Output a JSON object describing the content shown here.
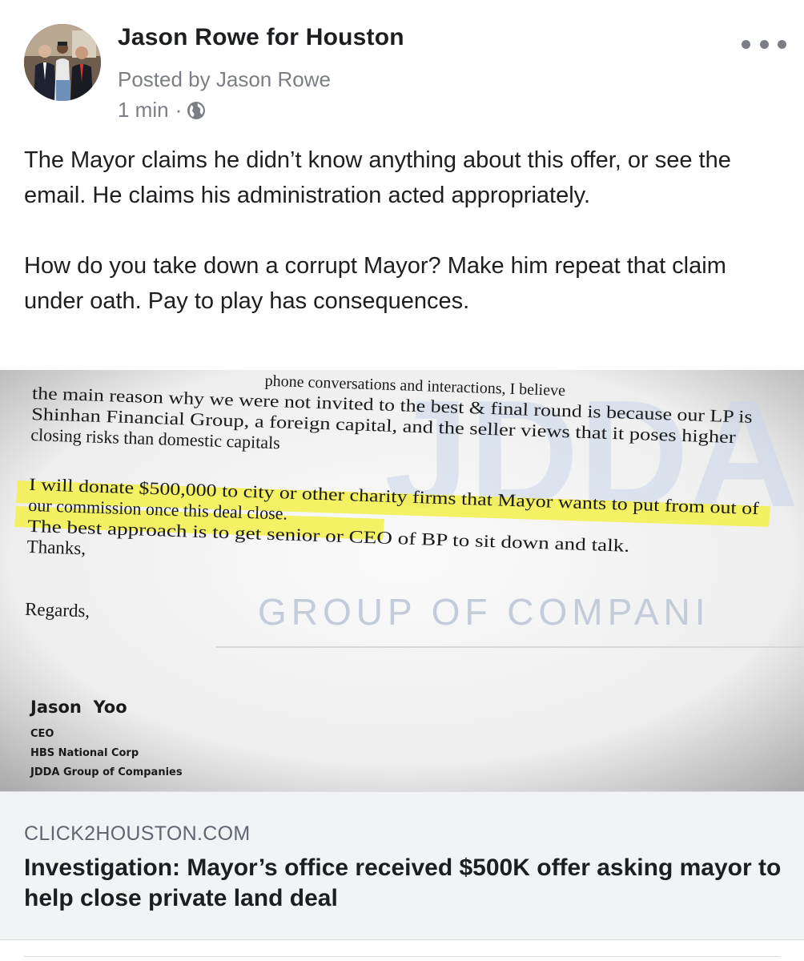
{
  "post": {
    "page_name": "Jason Rowe for Houston",
    "posted_by": "Posted by Jason Rowe",
    "timestamp": "1 min",
    "separator": "·",
    "privacy_icon": "globe-icon",
    "more_icon": "more-options-icon",
    "paragraphs": [
      "The Mayor claims he didn’t know anything about this offer, or see the email. He claims his administration acted appropriately.",
      "How do you take down a corrupt Mayor? Make him repeat that claim under oath. Pay to play has consequences."
    ]
  },
  "attachment": {
    "document_lines": [
      "the main reason why we were not invited to the best & final round is because our LP is",
      "Shinhan Financial Group, a foreign capital, and the seller views that it poses higher",
      "closing risks than domestic capitals",
      "I will donate $500,000 to city or other charity firms that Mayor wants to put  from out of",
      "our commission once this deal close.",
      "The best approach is to get senior or CEO of BP to sit down and talk.",
      "Thanks,",
      "Regards,"
    ],
    "header_fragment": "phone conversations and interactions, I believe",
    "watermark_big": "JDDA",
    "watermark_small": "GROUP OF COMPANI",
    "signature_name": "Jason  Yoo",
    "signature_lines": [
      "CEO",
      "HBS National Corp",
      "JDDA Group of Companies"
    ],
    "highlight_color": "#f4f04a"
  },
  "link": {
    "domain": "CLICK2HOUSTON.COM",
    "title": "Investigation: Mayor’s office received $500K offer asking mayor to help close private land deal"
  },
  "colors": {
    "text": "#1c1e21",
    "secondary": "#7b7e84",
    "preview_bg": "#f2f3f5"
  }
}
